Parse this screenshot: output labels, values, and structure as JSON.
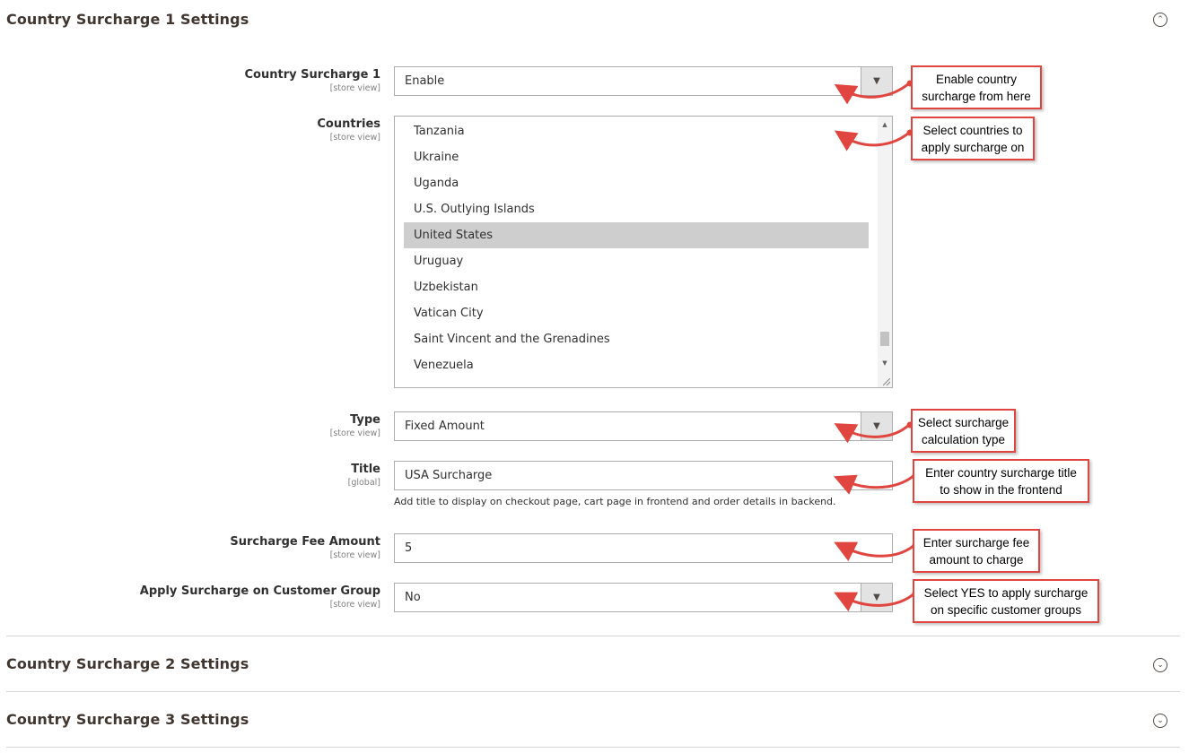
{
  "sections": [
    {
      "title": "Country Surcharge 1 Settings",
      "expanded": true
    },
    {
      "title": "Country Surcharge 2 Settings",
      "expanded": false
    },
    {
      "title": "Country Surcharge 3 Settings",
      "expanded": false
    }
  ],
  "fields": {
    "country_surcharge": {
      "label": "Country Surcharge 1",
      "scope": "[store view]",
      "value": "Enable"
    },
    "countries": {
      "label": "Countries",
      "scope": "[store view]",
      "options": [
        "Tanzania",
        "Ukraine",
        "Uganda",
        "U.S. Outlying Islands",
        "United States",
        "Uruguay",
        "Uzbekistan",
        "Vatican City",
        "Saint Vincent and the Grenadines",
        "Venezuela"
      ],
      "selected": "United States"
    },
    "type": {
      "label": "Type",
      "scope": "[store view]",
      "value": "Fixed Amount"
    },
    "title": {
      "label": "Title",
      "scope": "[global]",
      "value": "USA Surcharge",
      "note": "Add title to display on checkout page, cart page in frontend and order details in backend."
    },
    "fee_amount": {
      "label": "Surcharge Fee Amount",
      "scope": "[store view]",
      "value": "5"
    },
    "customer_group": {
      "label": "Apply Surcharge on Customer Group",
      "scope": "[store view]",
      "value": "No"
    }
  },
  "callouts": [
    {
      "line1": "Enable country",
      "line2": "surcharge from here"
    },
    {
      "line1": "Select countries to",
      "line2": "apply surcharge on"
    },
    {
      "line1": "Select surcharge",
      "line2": "calculation type"
    },
    {
      "line1": "Enter country surcharge title",
      "line2": "to show in the frontend"
    },
    {
      "line1": "Enter surcharge fee",
      "line2": "amount to charge"
    },
    {
      "line1": "Select YES to apply surcharge",
      "line2": "on specific customer groups"
    }
  ],
  "colors": {
    "callout_border": "#e0463f",
    "selected_option": "#cecece",
    "select_button": "#e3e3e3"
  },
  "icons": {
    "collapse": "chevron-up-circle-icon",
    "expand": "chevron-down-circle-icon",
    "dropdown": "triangle-down-icon"
  }
}
